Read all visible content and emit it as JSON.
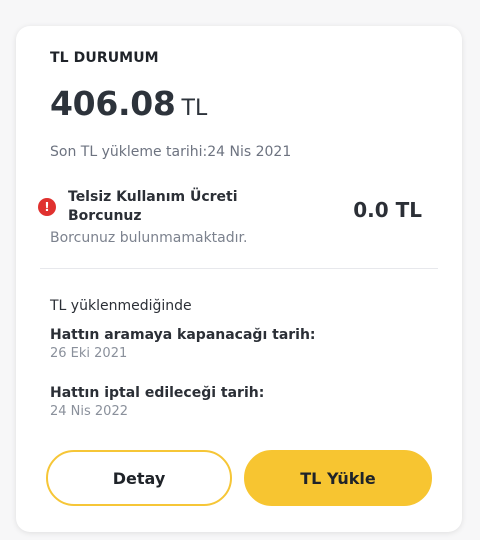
{
  "card": {
    "title": "TL DURUMUM",
    "balance": {
      "amount": "406.08",
      "unit": "TL"
    },
    "last_load": "Son TL yükleme tarihi:24 Nis 2021",
    "fee": {
      "icon": "alert-icon",
      "icon_glyph": "!",
      "label": "Telsiz Kullanım Ücreti Borcunuz",
      "amount": "0.0 TL",
      "status": "Borcunuz bulunmamaktadır."
    },
    "info": {
      "title": "TL yüklenmediğinde",
      "call_block": {
        "label": "Hattın aramaya kapanacağı tarih:",
        "value": "26 Eki 2021"
      },
      "cancel": {
        "label": "Hattın iptal edileceği tarih:",
        "value": "24 Nis 2022"
      }
    },
    "buttons": {
      "detail": "Detay",
      "load": "TL Yükle"
    }
  },
  "colors": {
    "accent": "#f7c531",
    "alert": "#e0312f",
    "text": "#2b2f36",
    "muted": "#7c828e"
  }
}
